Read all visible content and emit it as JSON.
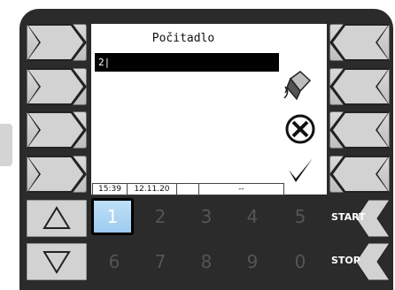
{
  "screen": {
    "title": "Počitadlo",
    "input_value": "2|",
    "status": {
      "time": "15:39",
      "date": "12.11.20",
      "field3": "",
      "field4": "--"
    }
  },
  "icons": {
    "edit": "eraser-icon",
    "cancel": "cancel-circle-icon",
    "confirm": "checkmark-icon"
  },
  "numpad": {
    "keys": [
      "1",
      "2",
      "3",
      "4",
      "5",
      "6",
      "7",
      "8",
      "9",
      "0"
    ],
    "selected": "1"
  },
  "controls": {
    "up": "up-arrow-icon",
    "down": "down-arrow-icon",
    "start_label": "START",
    "stop_label": "STOP"
  },
  "colors": {
    "bezel": "#2b2b2b",
    "key_selected": "#9dcbef",
    "key_inactive_text": "#555555"
  }
}
